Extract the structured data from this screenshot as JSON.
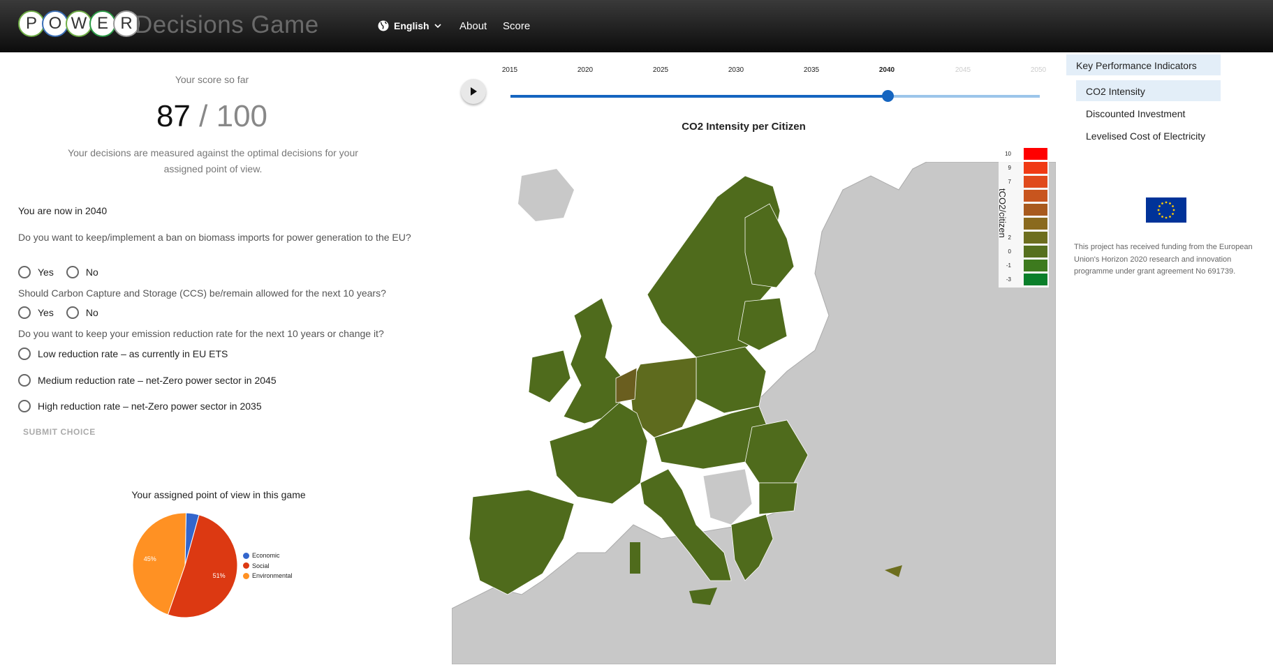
{
  "header": {
    "logo_letters": [
      "P",
      "O",
      "W",
      "E",
      "R"
    ],
    "title": "Decisions Game",
    "language": "English",
    "nav": {
      "about": "About",
      "score": "Score"
    }
  },
  "score": {
    "label": "Your score so far",
    "value": "87",
    "separator": "/",
    "max": "100",
    "description": "Your decisions are measured against the optimal decisions for your assigned point of view."
  },
  "questions": {
    "now": "You are now in 2040",
    "q1": "Do you want to keep/implement a ban on biomass imports for power generation to the EU?",
    "q2": "Should Carbon Capture and Storage (CCS) be/remain allowed for the next 10 years?",
    "q3": "Do you want to keep your emission reduction rate for the next 10 years or change it?",
    "yes": "Yes",
    "no": "No",
    "options": [
      "Low reduction rate – as currently in EU ETS",
      "Medium reduction rate – net-Zero power sector in 2045",
      "High reduction rate – net-Zero power sector in 2035"
    ],
    "submit": "SUBMIT CHOICE"
  },
  "point_of_view": {
    "title": "Your assigned point of view in this game",
    "slices": [
      {
        "name": "Economic",
        "value": 4,
        "color": "#3366cc"
      },
      {
        "name": "Social",
        "value": 51,
        "color": "#dc3912",
        "label": "51%"
      },
      {
        "name": "Environmental",
        "value": 45,
        "color": "#ff9123",
        "label": "45%"
      }
    ]
  },
  "timeline": {
    "years": [
      "2015",
      "2020",
      "2025",
      "2030",
      "2035",
      "2040",
      "2045",
      "2050"
    ],
    "current": "2040"
  },
  "map": {
    "title": "CO2 Intensity per Citizen",
    "legend_label": "tCO2/citizen",
    "legend_ticks": [
      "10",
      "9",
      "7",
      "",
      "",
      "",
      "2",
      "0",
      "-1",
      "-3"
    ],
    "legend_colors": [
      "#ff0000",
      "#f03a14",
      "#e04a1c",
      "#c8551e",
      "#a85a1e",
      "#8a6a1e",
      "#6d6e1e",
      "#56701e",
      "#3d7a1e",
      "#0a7f2a"
    ],
    "country_color": "#4f6b1c",
    "nonmember_color": "#c8c8c8"
  },
  "kpi": {
    "heading": "Key Performance Indicators",
    "items": [
      "CO2 Intensity",
      "Discounted Investment",
      "Levelised Cost of Electricity"
    ],
    "selected": 0
  },
  "funding_text": "This project has received funding from the European Union's Horizon 2020 research and innovation programme under grant agreement No 691739."
}
